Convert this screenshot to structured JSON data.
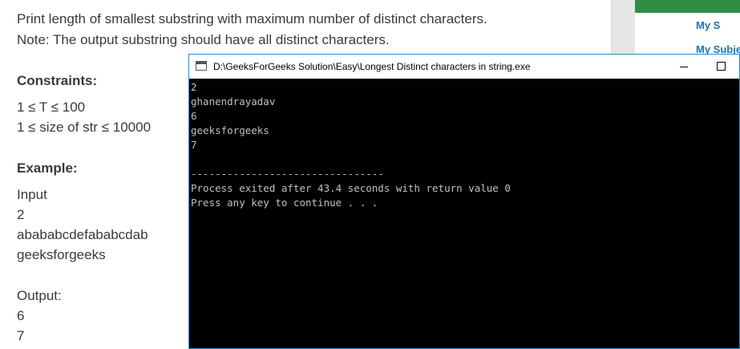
{
  "problem": {
    "desc_line1": "Print length of smallest substring with maximum number of distinct characters.",
    "desc_line2": "Note: The output substring should have all distinct characters.",
    "constraints_heading": "Constraints:",
    "constraint1": "1 ≤ T ≤ 100",
    "constraint2": "1 ≤ size of str ≤ 10000",
    "example_heading": "Example:",
    "input_label": "Input",
    "input_lines": [
      "2",
      "abababcdefababcdab",
      "geeksforgeeks"
    ],
    "output_label": "Output:",
    "output_lines": [
      "6",
      "7"
    ]
  },
  "sidebar": {
    "link1": "My S",
    "link2": "My Subje"
  },
  "console": {
    "title": "D:\\GeeksForGeeks Solution\\Easy\\Longest Distinct characters in string.exe",
    "lines": [
      "2",
      "ghanendrayadav",
      "6",
      "geeksforgeeks",
      "7",
      "",
      "--------------------------------",
      "Process exited after 43.4 seconds with return value 0",
      "Press any key to continue . . ."
    ]
  }
}
